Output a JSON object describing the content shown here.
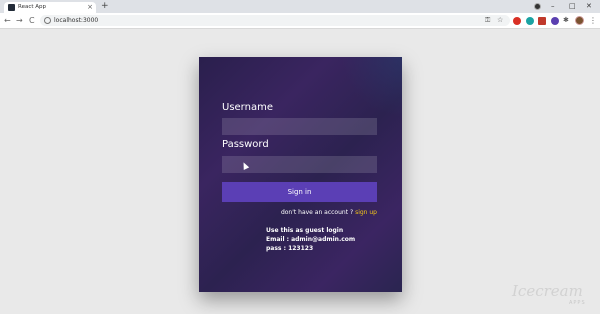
{
  "browser": {
    "tab_title": "React App",
    "tab_close": "×",
    "new_tab": "+",
    "back": "←",
    "forward": "→",
    "reload": "C",
    "url": "localhost:3000",
    "key_glyph": "⚿",
    "star_glyph": "☆",
    "puzzle_glyph": "✱",
    "menu_glyph": "⋮",
    "minimize": "–",
    "maximize": "□",
    "close": "✕"
  },
  "login": {
    "username_label": "Username",
    "username_value": "",
    "password_label": "Password",
    "password_value": "",
    "signin_label": "Sign in",
    "signup_prompt": "don't have an account ? ",
    "signup_link": "sign up",
    "guest_title": "Use this as guest login",
    "guest_email": "Email : admin@admin.com",
    "guest_pass": "pass : 123123"
  },
  "watermark": {
    "brand": "Icecream",
    "sub": "APPS"
  },
  "colors": {
    "accent": "#5b3fb5",
    "link": "#f5c518",
    "card_bg": "#2c2250"
  }
}
